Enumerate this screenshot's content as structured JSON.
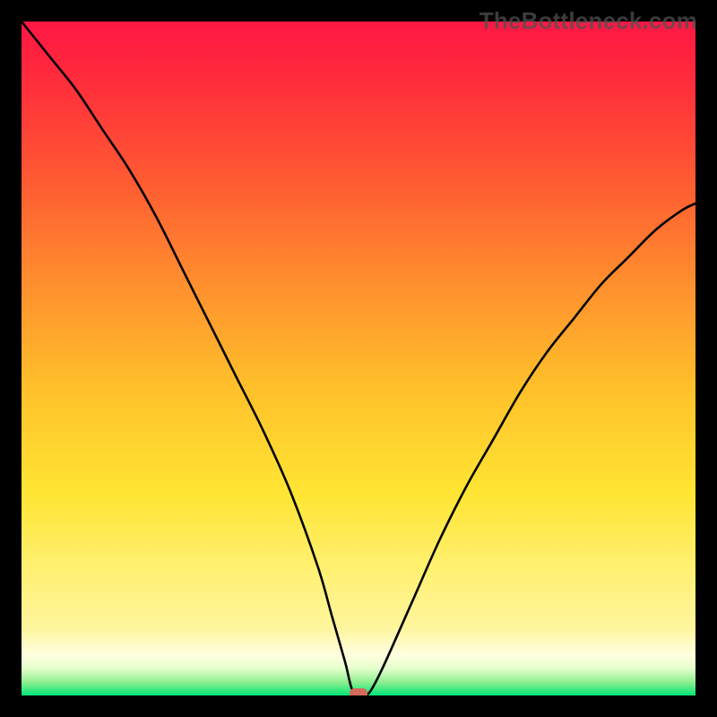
{
  "branding": {
    "watermark": "TheBottleneck.com"
  },
  "chart_data": {
    "type": "line",
    "title": "",
    "xlabel": "",
    "ylabel": "",
    "xlim": [
      0,
      100
    ],
    "ylim": [
      0,
      100
    ],
    "grid": false,
    "legend": false,
    "annotations": [],
    "series": [
      {
        "name": "bottleneck-curve",
        "x": [
          0,
          4,
          8,
          12,
          16,
          20,
          24,
          28,
          32,
          36,
          40,
          44,
          46,
          48,
          49,
          50,
          51,
          52,
          54,
          58,
          62,
          66,
          70,
          74,
          78,
          82,
          86,
          90,
          94,
          98,
          100
        ],
        "y": [
          100,
          95,
          90,
          84,
          78,
          71,
          63,
          55,
          47,
          39,
          30,
          19,
          12,
          5,
          1,
          0,
          0,
          1,
          5,
          14,
          23,
          31,
          38,
          45,
          51,
          56,
          61,
          65,
          69,
          72,
          73
        ]
      }
    ],
    "marker": {
      "name": "optimum-point",
      "x": 50,
      "y": 0
    },
    "background_gradient": {
      "top_color": "#ff1744",
      "bottom_color": "#00e676"
    }
  }
}
